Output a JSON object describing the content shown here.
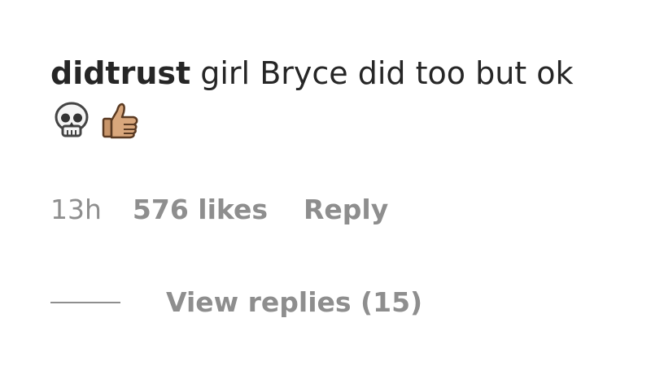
{
  "comment": {
    "username": "didtrust",
    "text": " girl Bryce did too but ok",
    "emojis": [
      "skull-emoji",
      "thumbs-up-emoji"
    ]
  },
  "meta": {
    "time": "13h",
    "likes": "576 likes",
    "reply_label": "Reply"
  },
  "replies": {
    "label": "View replies (15)"
  },
  "colors": {
    "text": "#262626",
    "secondary": "#8e8e8e",
    "background": "#ffffff"
  }
}
